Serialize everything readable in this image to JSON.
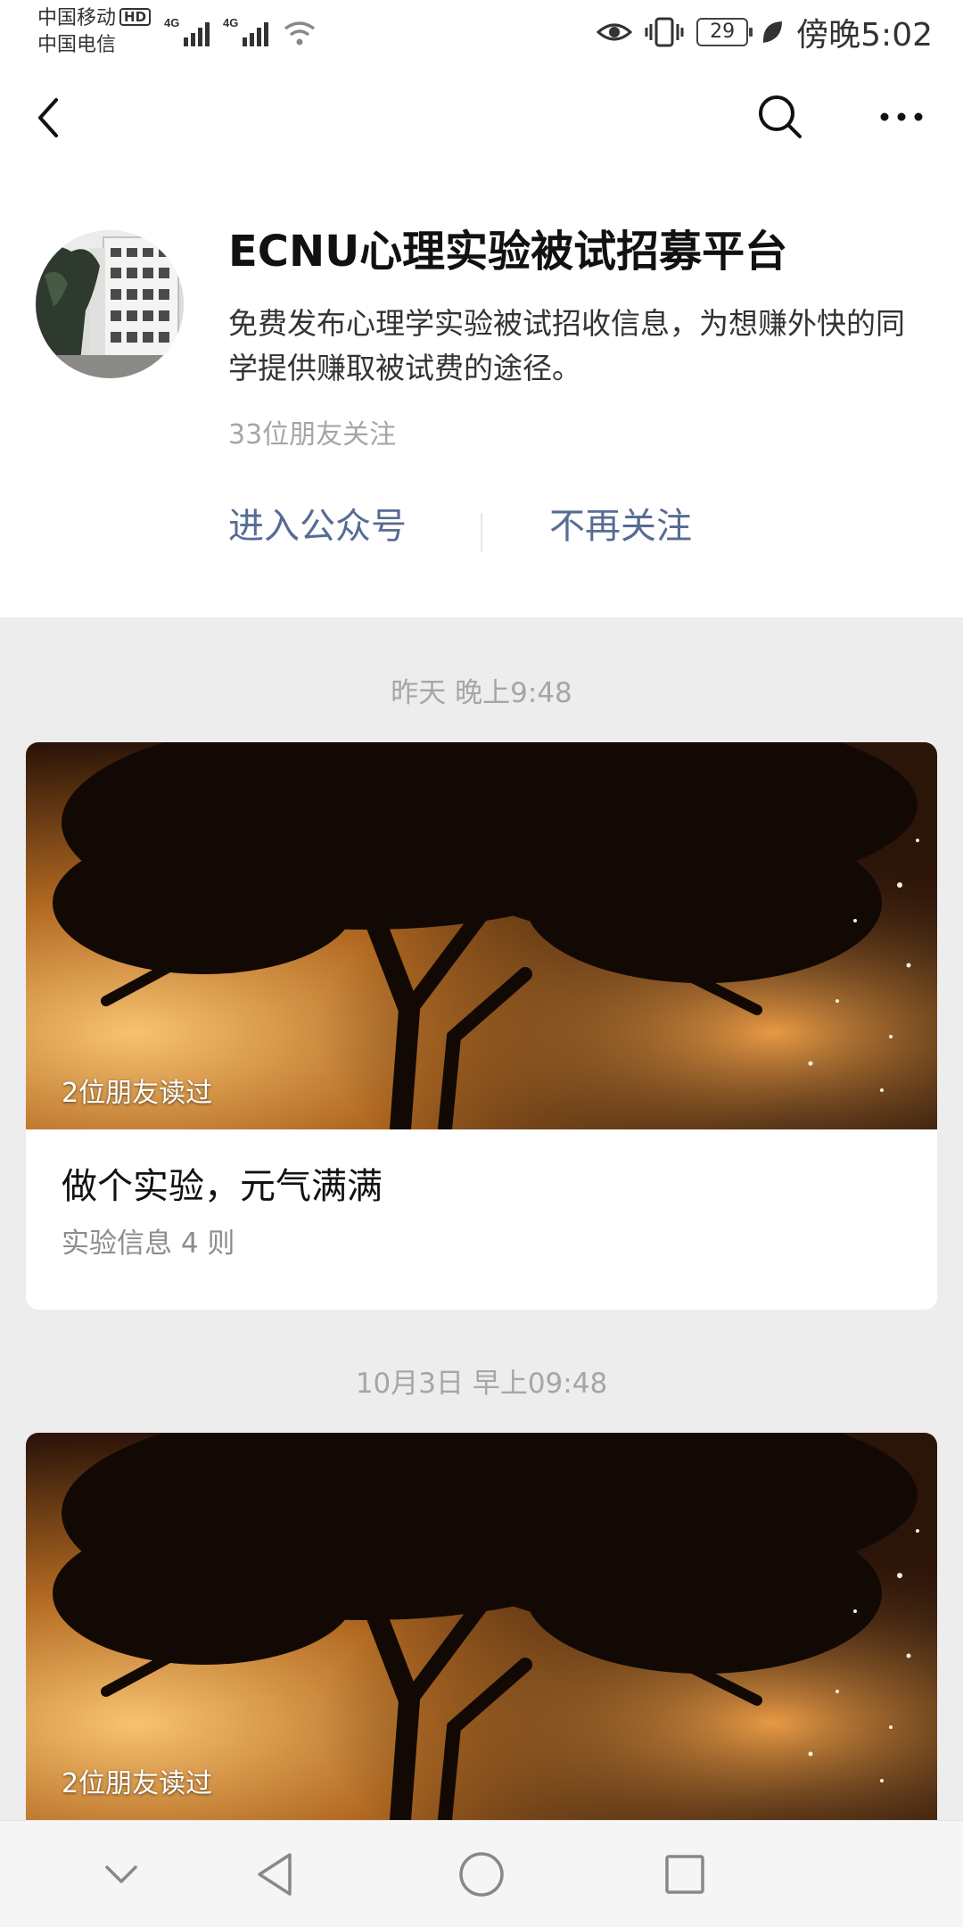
{
  "status_bar": {
    "carrier1": "中国移动",
    "hd_badge": "HD",
    "carrier2": "中国电信",
    "net1": "4G",
    "net2": "4G",
    "battery": "29",
    "time": "傍晚5:02"
  },
  "account": {
    "name": "ECNU心理实验被试招募平台",
    "description": "免费发布心理学实验被试招收信息，为想赚外快的同学提供赚取被试费的途径。",
    "followers": "33位朋友关注",
    "enter_label": "进入公众号",
    "unfollow_label": "不再关注"
  },
  "posts": [
    {
      "time": "昨天 晚上9:48",
      "read_tag": "2位朋友读过",
      "title": "做个实验，元气满满",
      "subtitle": "实验信息 4 则"
    },
    {
      "time": "10月3日 早上09:48",
      "read_tag": "2位朋友读过"
    }
  ],
  "icons": {
    "back": "back-icon",
    "search": "search-icon",
    "more": "more-icon",
    "eye": "eye-icon",
    "vibrate": "vibrate-icon",
    "leaf": "leaf-icon",
    "wifi": "wifi-icon"
  },
  "colors": {
    "link": "#576b95",
    "background": "#ededed",
    "muted": "#a6a6a6"
  }
}
